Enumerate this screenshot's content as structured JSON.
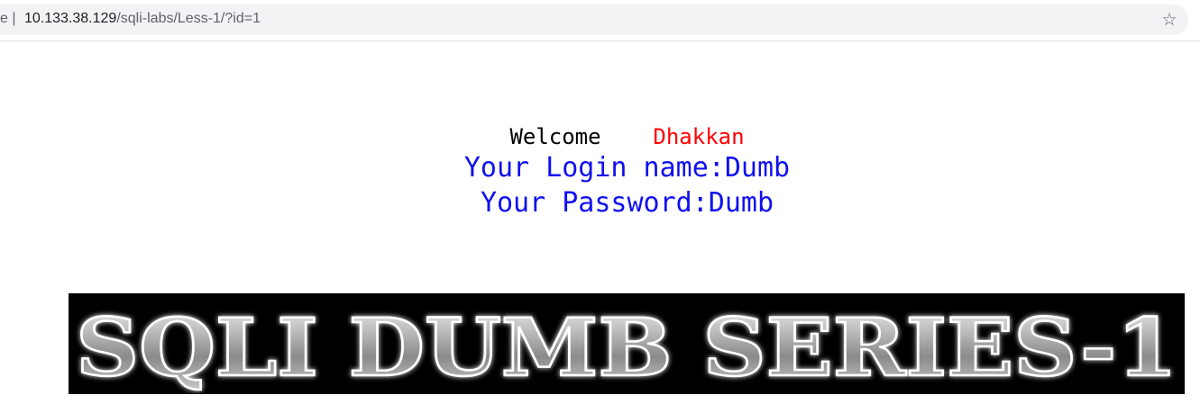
{
  "browser": {
    "url_prefix": "e |",
    "url_host": "10.133.38.129",
    "url_path": "/sqli-labs/Less-1/?id=1",
    "bookmark_icon": "star-icon"
  },
  "page": {
    "welcome_word": "Welcome",
    "welcome_name": "Dhakkan",
    "login_name_line": "Your Login name:Dumb",
    "password_line": "Your Password:Dumb",
    "banner_text": "SQLI DUMB SERIES-1"
  },
  "colors": {
    "welcome": "#000000",
    "name": "#ff0000",
    "credentials": "#1010f0",
    "banner_background": "#000000"
  }
}
